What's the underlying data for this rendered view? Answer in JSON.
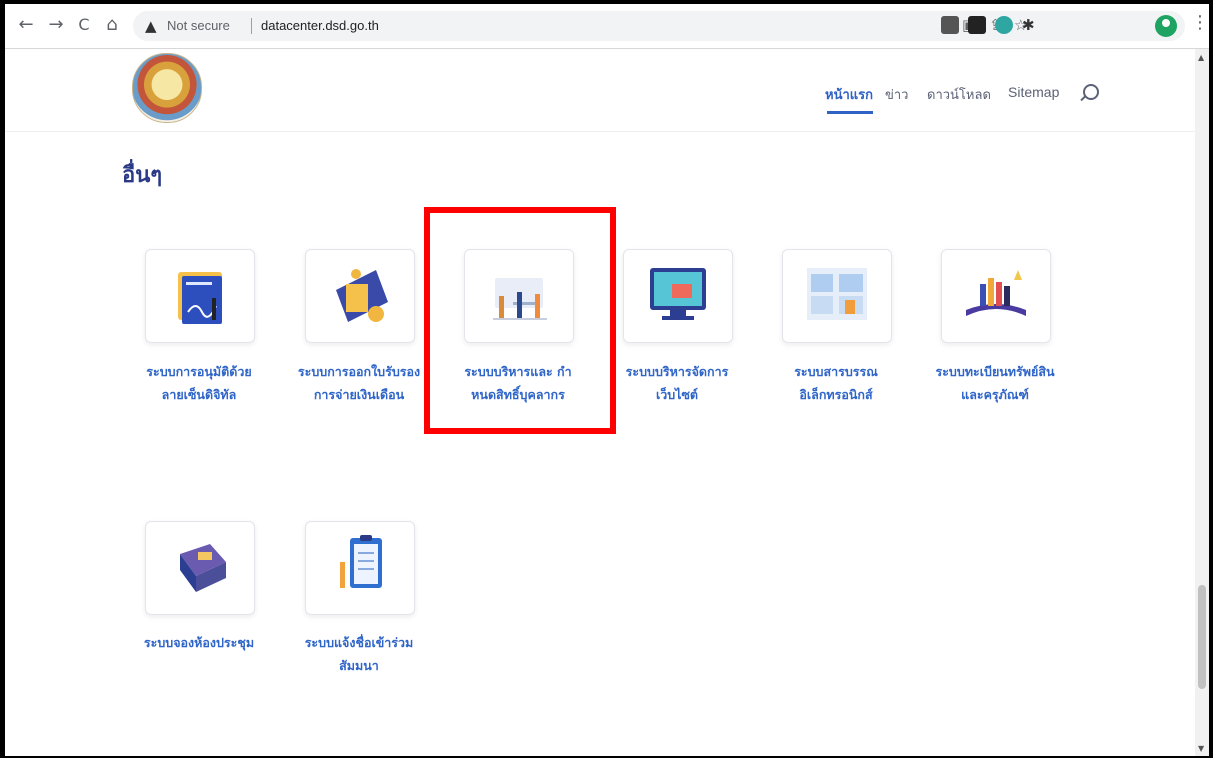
{
  "browser": {
    "back": "←",
    "forward": "→",
    "reload": "C",
    "home": "⌂",
    "security_label": "Not secure",
    "url": "datacenter.dsd.go.th",
    "menu": "⋮"
  },
  "header": {
    "nav": [
      "หน้าแรก",
      "ข่าว",
      "ดาวน์โหลด",
      "Sitemap"
    ],
    "active_index": 0
  },
  "section": {
    "title": "อื่นๆ"
  },
  "cards": [
    {
      "line1": "ระบบการอนุมัติด้วย",
      "line2": "ลายเซ็นดิจิทัล"
    },
    {
      "line1": "ระบบการออกใบรับรอง",
      "line2": "การจ่ายเงินเดือน"
    },
    {
      "line1": "ระบบบริหารและ กำ",
      "line2": "หนดสิทธิ์บุคลากร"
    },
    {
      "line1": "ระบบบริหารจัดการ",
      "line2": "เว็บไซต์"
    },
    {
      "line1": "ระบบสารบรรณ",
      "line2": "อิเล็กทรอนิกส์"
    },
    {
      "line1": "ระบบทะเบียนทรัพย์สิน",
      "line2": "และครุภัณฑ์"
    },
    {
      "line1": "ระบบจองห้องประชุม",
      "line2": ""
    },
    {
      "line1": "ระบบแจ้งชื่อเข้าร่วม",
      "line2": "สัมมนา"
    }
  ],
  "colors": {
    "accent": "#2e62c4",
    "title": "#2a3a86",
    "highlight": "#ff0000"
  }
}
